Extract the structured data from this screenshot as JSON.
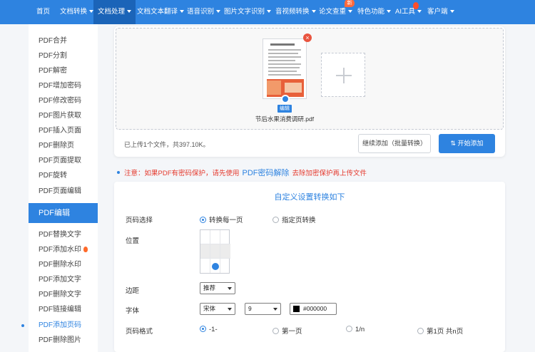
{
  "nav": {
    "items": [
      {
        "label": "首页",
        "caret": false
      },
      {
        "label": "文档转换",
        "caret": true
      },
      {
        "label": "文档处理",
        "caret": true
      },
      {
        "label": "文档文本翻译",
        "caret": true
      },
      {
        "label": "语音识别",
        "caret": true
      },
      {
        "label": "图片文字识别",
        "caret": true
      },
      {
        "label": "音视频转换",
        "caret": true
      },
      {
        "label": "论文查重",
        "caret": true
      },
      {
        "label": "特色功能",
        "caret": true
      },
      {
        "label": "AI工具",
        "caret": true
      },
      {
        "label": "客户端",
        "caret": true
      }
    ],
    "active": "文档处理",
    "new_badge": "新"
  },
  "sidebar": {
    "items_top": [
      "PDF合并",
      "PDF分割",
      "PDF解密",
      "PDF增加密码",
      "PDF修改密码",
      "PDF图片获取",
      "PDF插入页面",
      "PDF删除页",
      "PDF页面提取",
      "PDF旋转",
      "PDF页面编辑"
    ],
    "section_header": "PDF编辑",
    "items_bottom": [
      "PDF替换文字",
      "PDF添加水印",
      "PDF删除水印",
      "PDF添加文字",
      "PDF删除文字",
      "PDF链接编辑",
      "PDF添加页码",
      "PDF删除图片"
    ],
    "current": "PDF添加页码",
    "hot_item": "PDF添加水印"
  },
  "upload": {
    "file_name": "节后水果消费调研.pdf",
    "edit_label": "编辑",
    "close_symbol": "×",
    "info": "已上传1个文件，共397.10K。",
    "continue_label": "继续添加（批量转换）",
    "start_label": "⇅ 开始添加"
  },
  "warning": {
    "prefix": "注意：如果PDF有密码保护，请先使用",
    "link": "PDF密码解除",
    "suffix": "去除加密保护再上传文件"
  },
  "settings": {
    "title": "自定义设置转换如下",
    "page_select": {
      "label": "页码选择",
      "options": [
        "转换每一页",
        "指定页转换"
      ],
      "selected": "转换每一页"
    },
    "position": {
      "label": "位置",
      "selected": "bottom-center"
    },
    "margin": {
      "label": "边距",
      "value": "推荐"
    },
    "font": {
      "label": "字体",
      "family": "宋体",
      "size": "9",
      "color": "#000000"
    },
    "page_format": {
      "label": "页码格式",
      "options": [
        "-1-",
        "第一页",
        "1/n",
        "第1页 共n页"
      ],
      "selected": "-1-"
    }
  }
}
